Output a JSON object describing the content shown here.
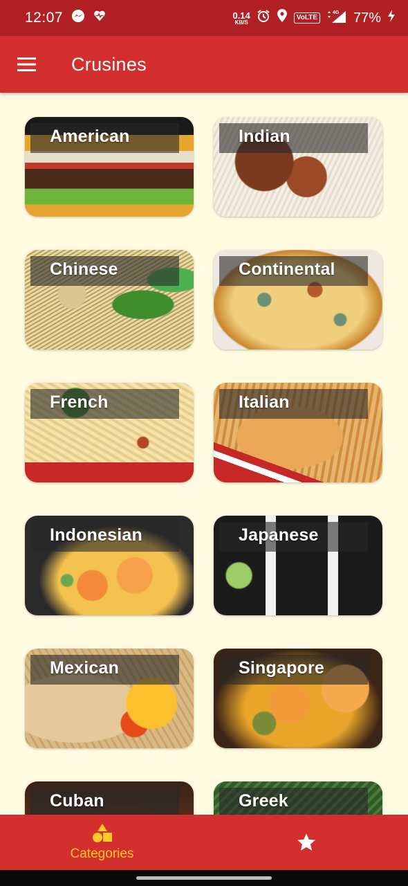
{
  "status_bar": {
    "time": "12:07",
    "net_speed_value": "0.14",
    "net_speed_unit": "KB/S",
    "volte": "VoLTE",
    "network": "4G",
    "battery": "77%"
  },
  "app_bar": {
    "title": "Crusines"
  },
  "categories": [
    {
      "label": "American"
    },
    {
      "label": "Indian"
    },
    {
      "label": "Chinese"
    },
    {
      "label": "Continental"
    },
    {
      "label": "French"
    },
    {
      "label": "Italian"
    },
    {
      "label": "Indonesian"
    },
    {
      "label": "Japanese"
    },
    {
      "label": "Mexican"
    },
    {
      "label": "Singapore"
    },
    {
      "label": "Cuban"
    },
    {
      "label": "Greek"
    }
  ],
  "bottom_nav": {
    "categories_label": "Categories",
    "favorites_icon": "star-icon",
    "categories_icon": "shapes-icon"
  },
  "colors": {
    "primary": "#d32f2f",
    "status_bar": "#b12024",
    "active_tab": "#ffca28",
    "background": "#fffbe0"
  }
}
